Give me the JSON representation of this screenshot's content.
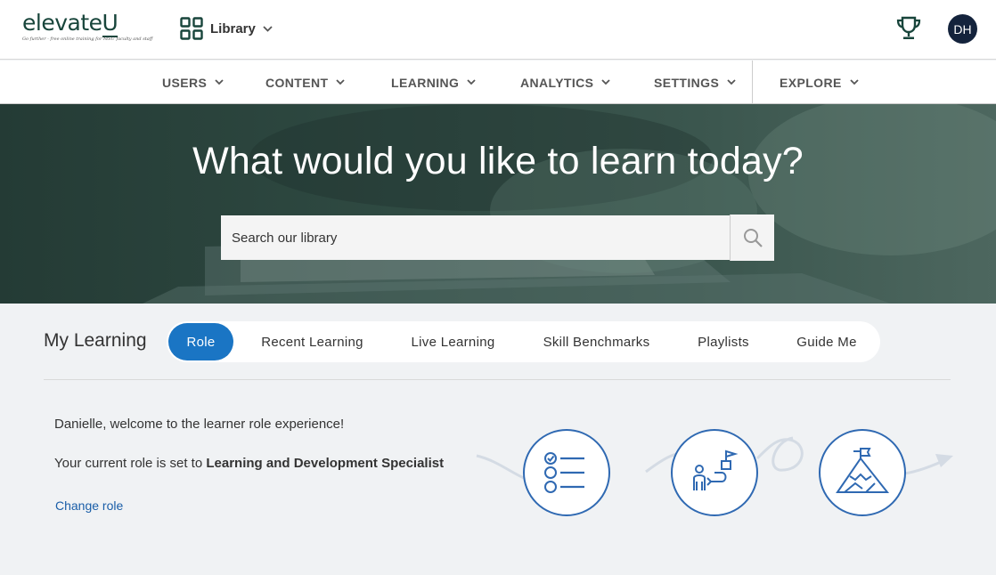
{
  "brand": {
    "name_prefix": "elevate",
    "name_suffix": "U",
    "tagline": "Go further · free online training for MSU faculty and staff"
  },
  "header": {
    "library_label": "Library",
    "avatar_initials": "DH"
  },
  "nav": {
    "items": [
      {
        "label": "USERS"
      },
      {
        "label": "CONTENT"
      },
      {
        "label": "LEARNING"
      },
      {
        "label": "ANALYTICS"
      },
      {
        "label": "SETTINGS"
      },
      {
        "label": "EXPLORE"
      }
    ]
  },
  "hero": {
    "title": "What would you like to learn today?",
    "search_placeholder": "Search our library"
  },
  "my_learning": {
    "title": "My Learning",
    "tabs": [
      {
        "label": "Role",
        "active": true
      },
      {
        "label": "Recent Learning",
        "active": false
      },
      {
        "label": "Live Learning",
        "active": false
      },
      {
        "label": "Skill Benchmarks",
        "active": false
      },
      {
        "label": "Playlists",
        "active": false
      },
      {
        "label": "Guide Me",
        "active": false
      }
    ],
    "welcome": "Danielle, welcome to the learner role experience!",
    "role_prefix": "Your current role is set to ",
    "role_name": "Learning and Development Specialist",
    "change_role": "Change role"
  },
  "colors": {
    "brand_green": "#18453b",
    "accent_blue": "#1a75c4",
    "icon_blue": "#2f69b2",
    "avatar_navy": "#14233c"
  },
  "icons": [
    "spartan-helmet-logo",
    "grid-icon",
    "chevron-down-icon",
    "trophy-icon",
    "search-icon",
    "checklist-icon",
    "path-flag-icon",
    "mountain-flag-icon"
  ]
}
